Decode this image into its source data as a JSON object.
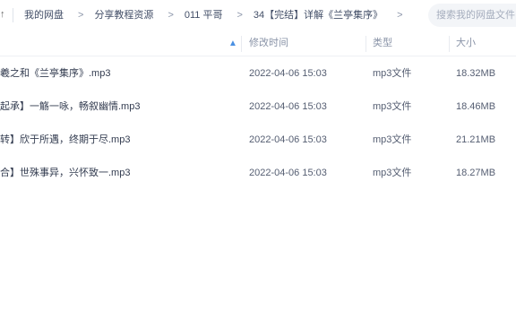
{
  "breadcrumb": {
    "items": [
      "我的网盘",
      "分享教程资源",
      "011 平哥",
      "34【完结】详解《兰亭集序》"
    ],
    "separator": ">"
  },
  "search": {
    "placeholder": "搜索我的网盘文件"
  },
  "table": {
    "headers": {
      "modified": "修改时间",
      "type": "类型",
      "size": "大小"
    },
    "rows": [
      {
        "name": "羲之和《兰亭集序》.mp3",
        "modified": "2022-04-06 15:03",
        "type": "mp3文件",
        "size": "18.32MB"
      },
      {
        "name": "起承】一觞一咏，畅叙幽情.mp3",
        "modified": "2022-04-06 15:03",
        "type": "mp3文件",
        "size": "18.46MB"
      },
      {
        "name": "转】欣于所遇，终期于尽.mp3",
        "modified": "2022-04-06 15:03",
        "type": "mp3文件",
        "size": "21.21MB"
      },
      {
        "name": "合】世殊事异，兴怀致一.mp3",
        "modified": "2022-04-06 15:03",
        "type": "mp3文件",
        "size": "18.27MB"
      }
    ]
  },
  "colors": {
    "accent": "#4a90e2",
    "text": "#333c50",
    "muted": "#8a94a8"
  }
}
